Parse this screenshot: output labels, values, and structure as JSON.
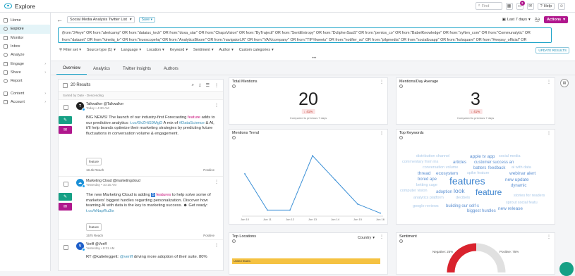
{
  "app": {
    "title": "Explore"
  },
  "topbar": {
    "search_placeholder": "Find",
    "notif_count": "3",
    "help": "Help"
  },
  "sidebar": {
    "items": [
      {
        "label": "Home",
        "icon": "home-icon",
        "active": false
      },
      {
        "label": "Explore",
        "icon": "explore-icon",
        "active": true
      },
      {
        "label": "Monitor",
        "icon": "monitor-icon",
        "active": false
      },
      {
        "label": "Inbox",
        "icon": "inbox-icon",
        "active": false
      },
      {
        "label": "Analyze",
        "icon": "analyze-icon",
        "active": false
      },
      {
        "label": "Engage",
        "icon": "engage-icon",
        "active": false,
        "chevron": "›"
      },
      {
        "label": "Share",
        "icon": "share-icon",
        "active": false,
        "chevron": "›"
      },
      {
        "label": "Report",
        "icon": "report-icon",
        "active": false
      },
      {
        "label": "Content",
        "icon": "content-icon",
        "active": false,
        "chevron": "›"
      },
      {
        "label": "Account",
        "icon": "account-icon",
        "active": false,
        "chevron": "›"
      }
    ]
  },
  "query": {
    "name": "Social Media Analysis Twitter List",
    "save": "Save",
    "date_range": "Last 7 days",
    "actions": "Actions",
    "line1": "(from:\"24eye\" OR from:\"alertcamp\" OR from:\"dataiux_tech\" OR from:\"doxa_star\" OR from:\"ChapsVision\" OR from:\"ByTrajectl\" OR from:\"SentiEntropy\" OR from:\"DclipherSaaS\" OR from:\"pentos_co\" OR from:\"BabelKnowledge\" OR from:\"syften_com\" OR from:\"Communalytic\" OR",
    "line2": "from:\"dataset\" OR from:\"kinetiq_tv\" OR from:\"truescopehq\" OR from:\"AnalyticsBloom\" OR from:\"navigatorLR\" OR from:\"VAIVcompany\" OR from:\"TIFYtweets\" OR from:\"notifier_so\" OR from:\"pilgmedia\" OR from:\"socialbuapp\" OR from:\"kolsquare\" OR from:\"Heepsy_official\" OR",
    "filters": [
      "Filter set",
      "Source type (1)",
      "Language",
      "Location",
      "Keyword",
      "Sentiment",
      "Author",
      "Custom categories"
    ],
    "update": "UPDATE RESULTS"
  },
  "tabs": [
    "Overview",
    "Analytics",
    "Twitter Insights",
    "Authors"
  ],
  "results": {
    "count_label": "20 Results",
    "sort_label": "Sorted by Date - Descending",
    "posts": [
      {
        "author": "Talkwalker @Talkwalker",
        "time": "Today • 4:30 AM",
        "avatar_color": "#222222",
        "avatar_letter": "T",
        "t1": "BIG NEWS! The launch of our industry-first Forecasting ",
        "hl": "feature",
        "t2": " adds to our predictive analytics: ",
        "link": "t.co/6hZHtS9MgD",
        "t3": " A mix of ",
        "tag": "#DataScience",
        "t4": " & AI, it'll help brands optimize their marketing strategies by predicting future fluctuations in conversation volume & engagement.",
        "chip": "feature",
        "reach": "18.4k Reach",
        "sentiment": "Positive"
      },
      {
        "author": "Marketing Cloud @marketingcloud",
        "time": "Yesterday • 10:15 AM",
        "avatar_color": "#1a8fd6",
        "avatar_letter": "☁",
        "t1": "The new Marketing Cloud is adding ",
        "emoji": "5",
        "t1b": " ",
        "hl": "features",
        "t2": " to help solve some of marketers' biggest hurdles regarding personalization. Discover how teaming AI with data is the key to marketing success. ",
        "t3": "Get ready: ",
        "link": "t.co/hNapRu3ix",
        "chip": "feature",
        "reach": "157k Reach",
        "sentiment": "Positive"
      },
      {
        "author": "Veriff @Veriff",
        "time": "Yesterday • 8:31 AM",
        "avatar_color": "#1d5ec9",
        "avatar_letter": "V",
        "t1": "RT @katieleggett: ",
        "link": "@veriff",
        "t2": " driving more adoption of their suite. 80%"
      }
    ]
  },
  "cards": {
    "total_mentions": {
      "title": "Total Mentions",
      "value": "20",
      "change": "↓ 41%",
      "compare": "Compared to previous 7 days"
    },
    "mentions_day": {
      "title": "Mentions/Day Average",
      "value": "3",
      "change": "↓ 41%",
      "compare": "Compared to previous 7 days"
    },
    "trend": {
      "title": "Mentions Trend"
    },
    "keywords": {
      "title": "Top Keywords"
    },
    "locations": {
      "title": "Top Locations",
      "selector": "Country",
      "bar_label": "United States"
    },
    "sentiment": {
      "title": "Sentiment",
      "negative": "Negative: 25%",
      "positive": "Positive: 75%"
    }
  },
  "chart_data": {
    "type": "line",
    "title": "Mentions Trend",
    "x": [
      "Jun 10",
      "Jun 11",
      "Jun 12",
      "Jun 13",
      "Jun 14",
      "Jun 15",
      "Jun 16"
    ],
    "values": [
      7,
      1,
      1,
      10,
      6,
      2,
      0.5
    ],
    "ylim": [
      0,
      12
    ],
    "color": "#3a8fd6"
  },
  "keywords": [
    {
      "w": "distribution channel",
      "c": "#a9c8e8",
      "s": 5.5
    },
    {
      "w": "apple tv app",
      "c": "#5b8fd1",
      "s": 6.5
    },
    {
      "w": "social media",
      "c": "#a9c8e8",
      "s": 5.5
    },
    {
      "w": "commentary from ins",
      "c": "#a9c8e8",
      "s": 5.5
    },
    {
      "w": "articles",
      "c": "#5b8fd1",
      "s": 6
    },
    {
      "w": "customer success an",
      "c": "#5b8fd1",
      "s": 6
    },
    {
      "w": "conversation volume",
      "c": "#a9c8e8",
      "s": 5.5
    },
    {
      "w": "batters",
      "c": "#5b8fd1",
      "s": 6
    },
    {
      "w": "feedback",
      "c": "#5b8fd1",
      "s": 6
    },
    {
      "w": "ai with data",
      "c": "#a9c8e8",
      "s": 5.5
    },
    {
      "w": "thread",
      "c": "#5b8fd1",
      "s": 6.5
    },
    {
      "w": "ecosystem",
      "c": "#5b8fd1",
      "s": 6.5
    },
    {
      "w": "spike feature",
      "c": "#a9c8e8",
      "s": 5.5
    },
    {
      "w": "webinar alert",
      "c": "#5b8fd1",
      "s": 6.5
    },
    {
      "w": "bored ape",
      "c": "#5b8fd1",
      "s": 6
    },
    {
      "w": "features",
      "c": "#3d84cf",
      "s": 14
    },
    {
      "w": "new update",
      "c": "#5b8fd1",
      "s": 6.5
    },
    {
      "w": "betting cage",
      "c": "#a9c8e8",
      "s": 5.5
    },
    {
      "w": "dynamic",
      "c": "#5b8fd1",
      "s": 6
    },
    {
      "w": "computer vision",
      "c": "#a9c8e8",
      "s": 5.5
    },
    {
      "w": "adoption",
      "c": "#5b8fd1",
      "s": 6
    },
    {
      "w": "look",
      "c": "#5b8fd1",
      "s": 8.5
    },
    {
      "w": "feature",
      "c": "#3d84cf",
      "s": 12
    },
    {
      "w": "stories for readers",
      "c": "#a9c8e8",
      "s": 5.5
    },
    {
      "w": "analytics platform",
      "c": "#a9c8e8",
      "s": 5.5
    },
    {
      "w": "decibels",
      "c": "#a9c8e8",
      "s": 5.5
    },
    {
      "w": "sprout social featu",
      "c": "#a9c8e8",
      "s": 5.5
    },
    {
      "w": "google reviews",
      "c": "#a9c8e8",
      "s": 5.5
    },
    {
      "w": "building our self-s",
      "c": "#5b8fd1",
      "s": 6
    },
    {
      "w": "new release",
      "c": "#5b8fd1",
      "s": 6.5
    },
    {
      "w": "biggest hurdles",
      "c": "#5b8fd1",
      "s": 6
    }
  ]
}
